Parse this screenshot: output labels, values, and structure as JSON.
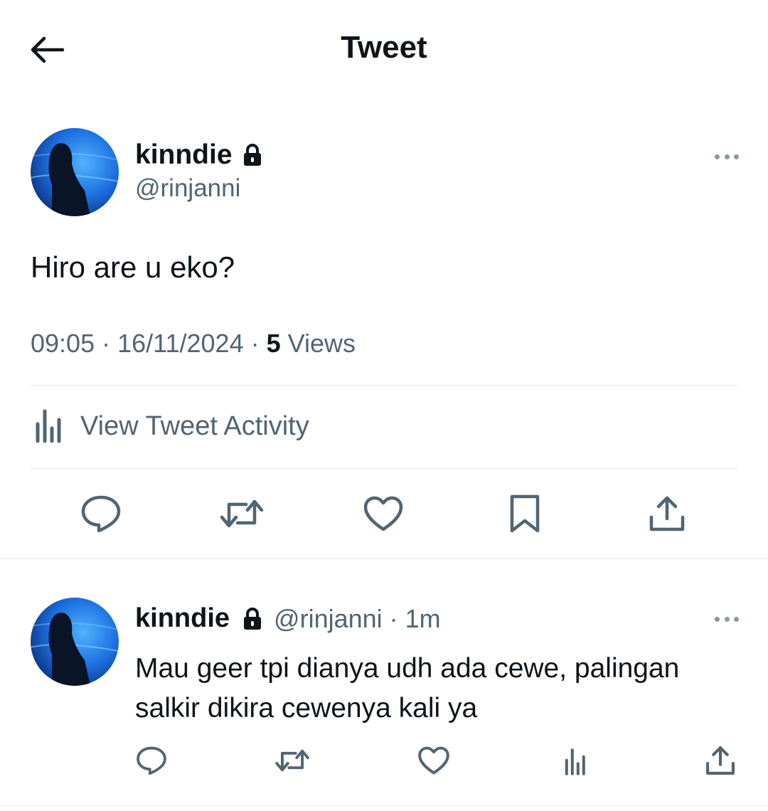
{
  "header": {
    "title": "Tweet",
    "back_icon": "arrow-left-icon"
  },
  "main_tweet": {
    "display_name": "kinndie",
    "handle": "@rinjanni",
    "text": "Hiro are u eko?",
    "time": "09:05",
    "date": "16/11/2024",
    "views_count": "5",
    "views_label": "Views",
    "activity_label": "View Tweet Activity",
    "actions": [
      "reply-icon",
      "retweet-icon",
      "like-icon",
      "bookmark-icon",
      "share-icon"
    ]
  },
  "reply": {
    "display_name": "kinndie",
    "handle": "@rinjanni",
    "time_ago": "1m",
    "text": "Mau geer tpi dianya udh ada cewe, palingan salkir dikira cewenya kali ya",
    "actions": [
      "reply-icon",
      "retweet-icon",
      "like-icon",
      "views-chart-icon",
      "share-icon"
    ]
  },
  "colors": {
    "text": "#0f1419",
    "secondary": "#536471",
    "icon": "#536471",
    "divider": "#e6ecf0"
  }
}
